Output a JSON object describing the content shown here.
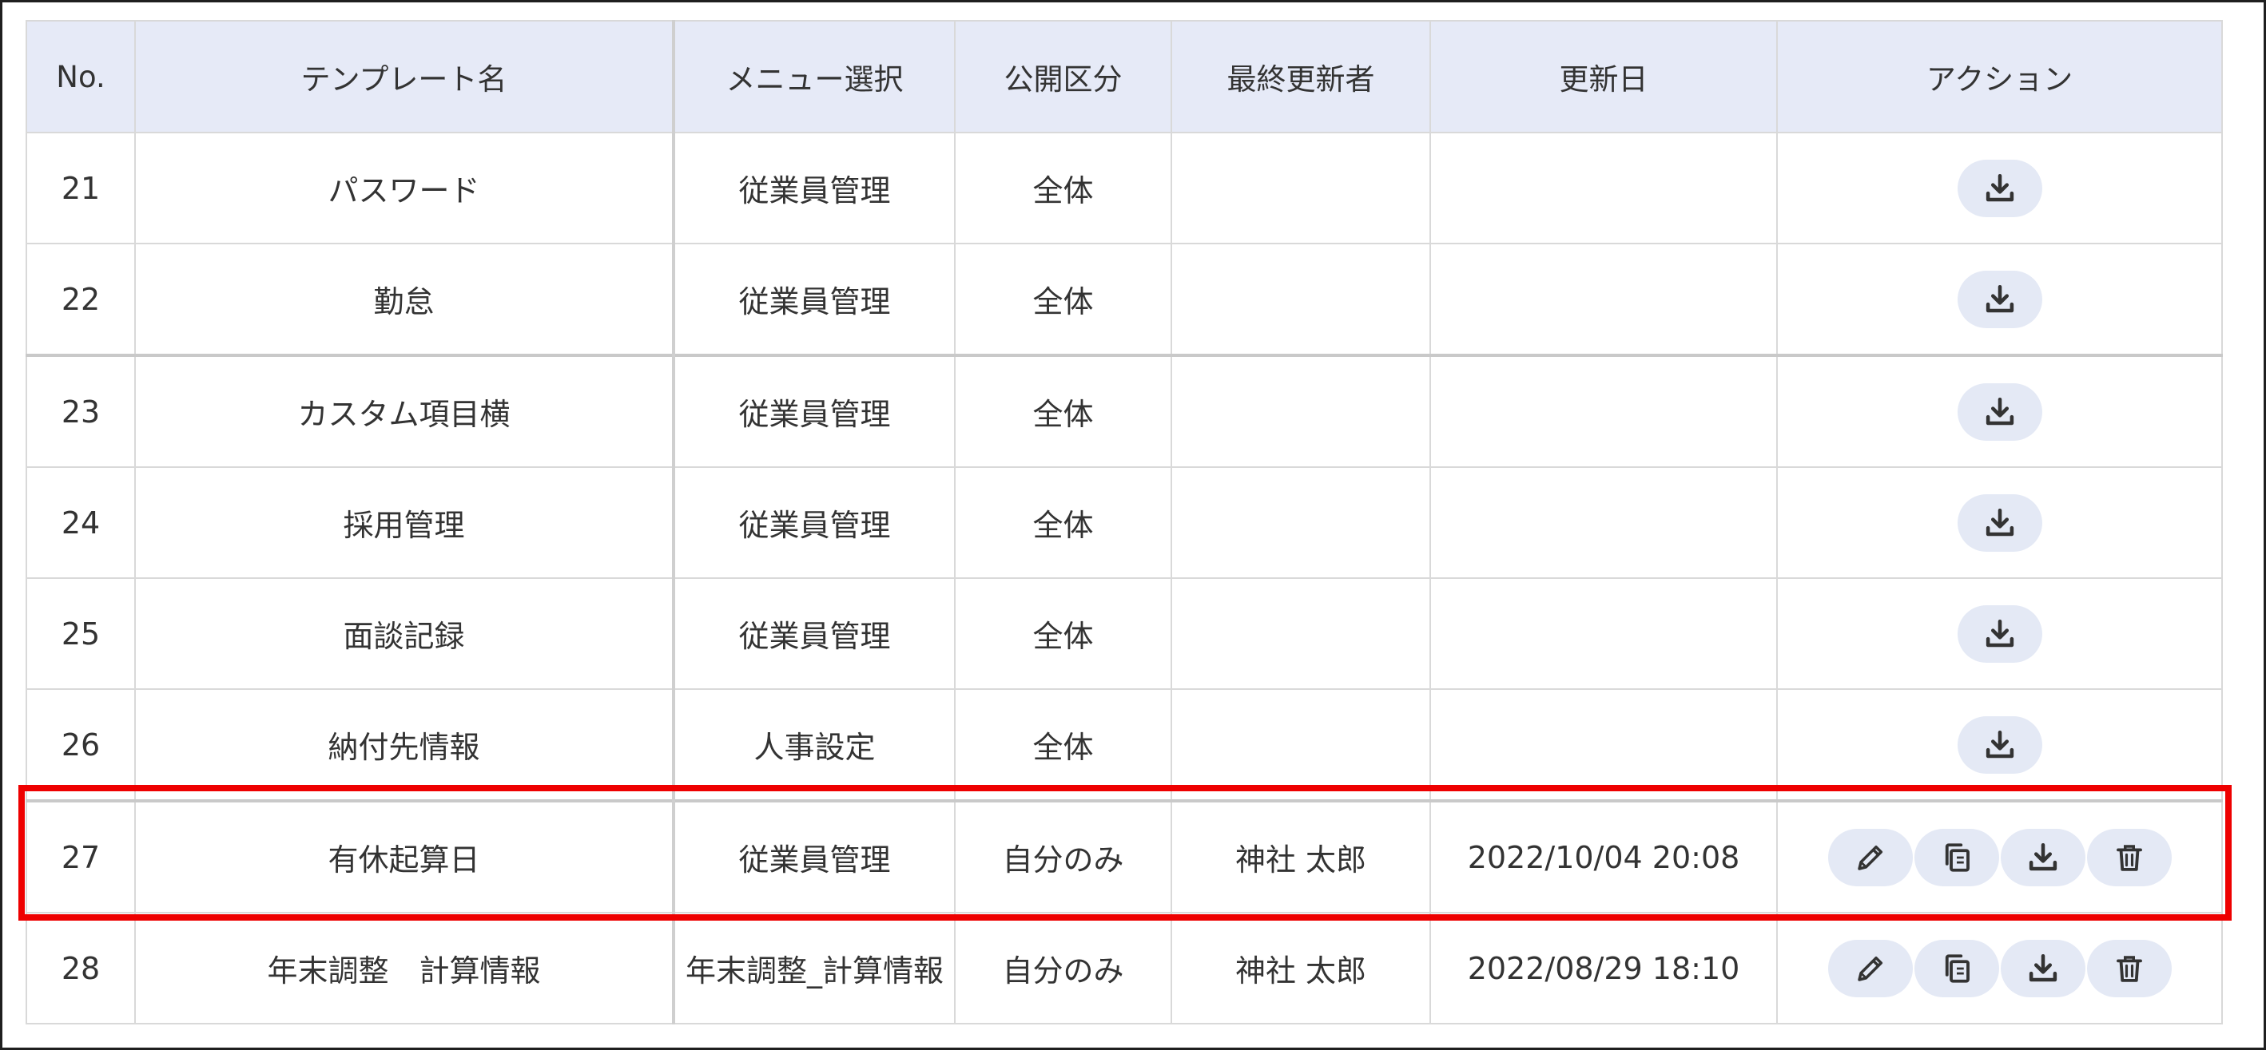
{
  "columns": {
    "no": "No.",
    "template_name": "テンプレート名",
    "menu": "メニュー選択",
    "visibility": "公開区分",
    "updater": "最終更新者",
    "updated_at": "更新日",
    "actions": "アクション"
  },
  "rows": [
    {
      "no": "21",
      "name": "パスワード",
      "menu": "従業員管理",
      "visibility": "全体",
      "updater": "",
      "updated_at": "",
      "actions": [
        "download-icon"
      ]
    },
    {
      "no": "22",
      "name": "勤怠",
      "menu": "従業員管理",
      "visibility": "全体",
      "updater": "",
      "updated_at": "",
      "actions": [
        "download-icon"
      ]
    },
    {
      "no": "23",
      "name": "カスタム項目横",
      "menu": "従業員管理",
      "visibility": "全体",
      "updater": "",
      "updated_at": "",
      "actions": [
        "download-icon"
      ]
    },
    {
      "no": "24",
      "name": "採用管理",
      "menu": "従業員管理",
      "visibility": "全体",
      "updater": "",
      "updated_at": "",
      "actions": [
        "download-icon"
      ]
    },
    {
      "no": "25",
      "name": "面談記録",
      "menu": "従業員管理",
      "visibility": "全体",
      "updater": "",
      "updated_at": "",
      "actions": [
        "download-icon"
      ]
    },
    {
      "no": "26",
      "name": "納付先情報",
      "menu": "人事設定",
      "visibility": "全体",
      "updater": "",
      "updated_at": "",
      "actions": [
        "download-icon"
      ]
    },
    {
      "no": "27",
      "name": "有休起算日",
      "menu": "従業員管理",
      "visibility": "自分のみ",
      "updater": "神社 太郎",
      "updated_at": "2022/10/04 20:08",
      "actions": [
        "pencil-icon",
        "copy-icon",
        "download-icon",
        "trash-icon"
      ]
    },
    {
      "no": "28",
      "name": "年末調整　計算情報",
      "menu": "年末調整_計算情報",
      "visibility": "自分のみ",
      "updater": "神社 太郎",
      "updated_at": "2022/08/29 18:10",
      "actions": [
        "pencil-icon",
        "copy-icon",
        "download-icon",
        "trash-icon"
      ]
    }
  ],
  "highlighted_row": "27",
  "colors": {
    "header_bg": "#e6eaf7",
    "action_button_bg": "#e4e9f5",
    "icon": "#333333",
    "highlight_border": "#ee0000"
  }
}
